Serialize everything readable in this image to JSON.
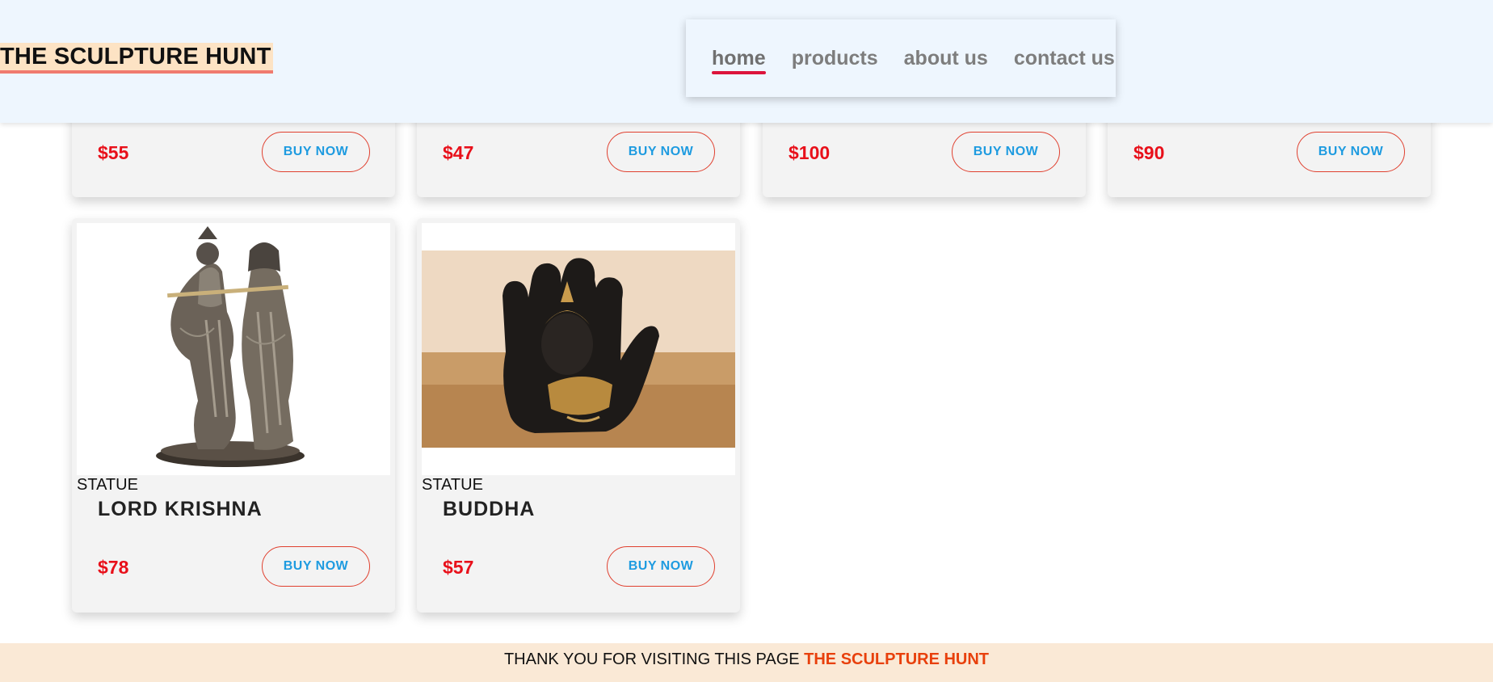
{
  "header": {
    "logo": "THE SCULPTURE HUNT",
    "nav": [
      {
        "label": "home",
        "active": true
      },
      {
        "label": "products",
        "active": false
      },
      {
        "label": "about us",
        "active": false
      },
      {
        "label": "contact us",
        "active": false
      }
    ]
  },
  "products_top_row": [
    {
      "price": "$55",
      "button": "BUY NOW"
    },
    {
      "price": "$47",
      "button": "BUY NOW"
    },
    {
      "price": "$100",
      "button": "BUY NOW"
    },
    {
      "price": "$90",
      "button": "BUY NOW"
    }
  ],
  "products": [
    {
      "category": "STATUE",
      "name": "LORD KRISHNA",
      "price": "$78",
      "button": "BUY NOW",
      "image": "krishna-statue"
    },
    {
      "category": "STATUE",
      "name": "BUDDHA",
      "price": "$57",
      "button": "BUY NOW",
      "image": "buddha-hand-statue"
    }
  ],
  "footer": {
    "text": "THANK YOU FOR VISITING THIS PAGE ",
    "brand": "THE SCULPTURE HUNT"
  },
  "colors": {
    "header_bg": "#eef6fe",
    "price": "#e8101a",
    "button_text": "#1e9be0",
    "button_border": "#e0402f",
    "nav_active_underline": "#dc143c",
    "footer_bg": "#fae9d6",
    "footer_brand": "#e8400c"
  }
}
